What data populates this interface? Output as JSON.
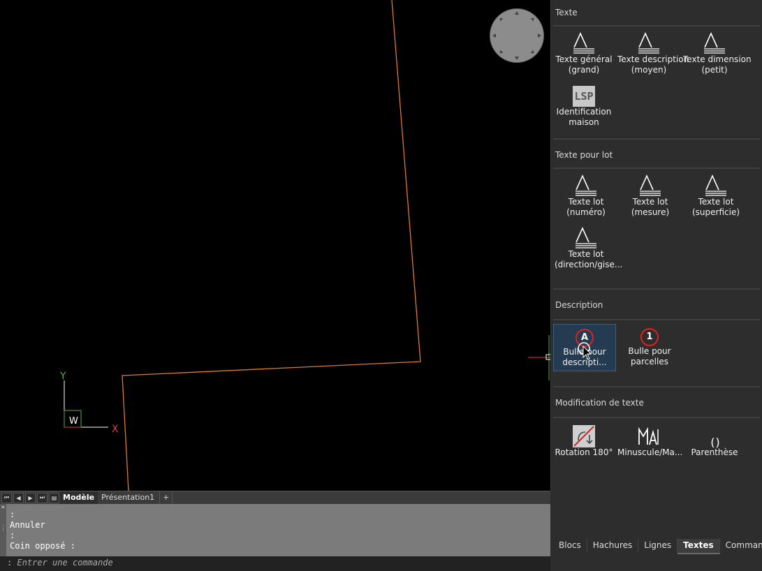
{
  "canvas": {
    "ucs": {
      "x_label": "X",
      "y_label": "Y",
      "w_label": "W"
    }
  },
  "layout_tabs": {
    "model": "Modèle",
    "layout1": "Présentation1",
    "add": "+"
  },
  "command_history": {
    "lines": [
      ":",
      "Annuler",
      ":",
      "Coin opposé :"
    ]
  },
  "command_input": {
    "prompt": ":",
    "placeholder": "Entrer une commande"
  },
  "palette": {
    "sections": {
      "texte": {
        "title": "Texte",
        "tools": [
          {
            "line1": "Texte général",
            "line2": "(grand)",
            "icon": "text-style-icon"
          },
          {
            "line1": "Texte description",
            "line2": "(moyen)",
            "icon": "text-style-icon"
          },
          {
            "line1": "Texte dimension",
            "line2": "(petit)",
            "icon": "text-style-icon"
          },
          {
            "line1": "Identification",
            "line2": "maison",
            "icon": "lsp-icon",
            "icon_text": "LSP"
          }
        ]
      },
      "texte_lot": {
        "title": "Texte pour lot",
        "tools": [
          {
            "line1": "Texte lot",
            "line2": "(numéro)",
            "icon": "text-style-icon"
          },
          {
            "line1": "Texte lot",
            "line2": "(mesure)",
            "icon": "text-style-icon"
          },
          {
            "line1": "Texte lot",
            "line2": "(superficie)",
            "icon": "text-style-icon"
          },
          {
            "line1": "Texte lot",
            "line2": "(direction/gise...",
            "icon": "text-style-icon"
          }
        ]
      },
      "description": {
        "title": "Description",
        "tools": [
          {
            "line1": "Bulle pour",
            "line2": "descripti...",
            "icon": "bubble-a-icon",
            "icon_text": "A"
          },
          {
            "line1": "Bulle pour",
            "line2": "parcelles",
            "icon": "bubble-1-icon",
            "icon_text": "1"
          }
        ]
      },
      "modification": {
        "title": "Modification de texte",
        "tools": [
          {
            "line1": "Rotation 180°",
            "icon": "rotate-180-icon"
          },
          {
            "line1": "Minuscule/Ma...",
            "icon": "case-toggle-icon"
          },
          {
            "line1": "Parenthèse",
            "icon": "parenthesis-icon",
            "icon_text": "()"
          }
        ]
      }
    },
    "tabs": [
      "Blocs",
      "Hachures",
      "Lignes",
      "Textes",
      "Commandes"
    ],
    "active_tab": "Textes"
  },
  "colors": {
    "canvas_bg": "#000000",
    "boundary_line": "#e07a2e",
    "ucs_y": "#4caf50",
    "ucs_x": "#e04040",
    "palette_bg": "#2d2d2d",
    "selected_tool_bg": "#243b52",
    "bubble_red": "#e02020"
  }
}
